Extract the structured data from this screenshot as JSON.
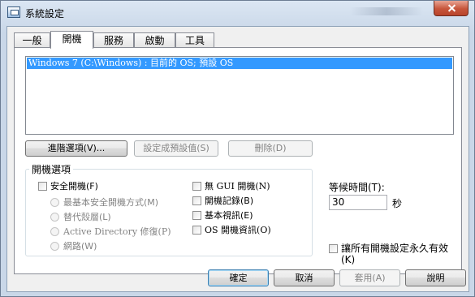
{
  "window": {
    "title": "系統設定"
  },
  "tabs": [
    {
      "label": "一般"
    },
    {
      "label": "開機"
    },
    {
      "label": "服務"
    },
    {
      "label": "啟動"
    },
    {
      "label": "工具"
    }
  ],
  "boot_list": {
    "items": [
      "Windows 7 (C:\\Windows) : 目前的 OS; 預設 OS"
    ]
  },
  "boot_buttons": {
    "advanced": "進階選項(V)...",
    "set_default": "設定成預設值(S)",
    "delete": "刪除(D)"
  },
  "boot_options": {
    "title": "開機選項",
    "safe_boot": "安全開機(F)",
    "radios": [
      "最基本安全開機方式(M)",
      "替代殼層(L)",
      "Active Directory 修復(P)",
      "網路(W)"
    ],
    "no_gui": "無 GUI 開機(N)",
    "boot_log": "開機記錄(B)",
    "base_video": "基本視訊(E)",
    "os_boot_info": "OS 開機資訊(O)"
  },
  "timeout": {
    "label": "等候時間(T):",
    "value": "30",
    "unit": "秒"
  },
  "permanent": {
    "label_line1": "讓所有開機設定永久有效",
    "label_line2": "(K)"
  },
  "dialog_buttons": {
    "ok": "確定",
    "cancel": "取消",
    "apply": "套用(A)",
    "help": "說明"
  }
}
